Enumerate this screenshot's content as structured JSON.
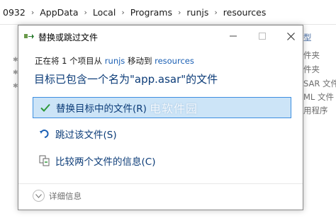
{
  "explorer": {
    "breadcrumbs": [
      "0932",
      "AppData",
      "Local",
      "Programs",
      "runjs",
      "resources"
    ],
    "side_types": [
      "型",
      "件夹",
      "件夹",
      "SAR 文件",
      "ML 文件",
      "用程序"
    ]
  },
  "dialog": {
    "title": "替换或跳过文件",
    "status": {
      "prefix": "正在将 1 个项目从 ",
      "source": "runjs",
      "middle": " 移动到 ",
      "destination": "resources"
    },
    "headline": "目标已包含一个名为\"app.asar\"的文件",
    "options": {
      "replace": "替换目标中的文件(R)",
      "skip": "跳过该文件(S)",
      "compare": "比较两个文件的信息(C)"
    },
    "details_label": "详细信息",
    "watermark": "电软件园"
  },
  "colors": {
    "accent_text": "#1a5fb4",
    "option_text": "#0c3c78",
    "selection_bg": "#cce4f7",
    "selection_border": "#3c8ee0",
    "check_green": "#2e9a3a"
  }
}
